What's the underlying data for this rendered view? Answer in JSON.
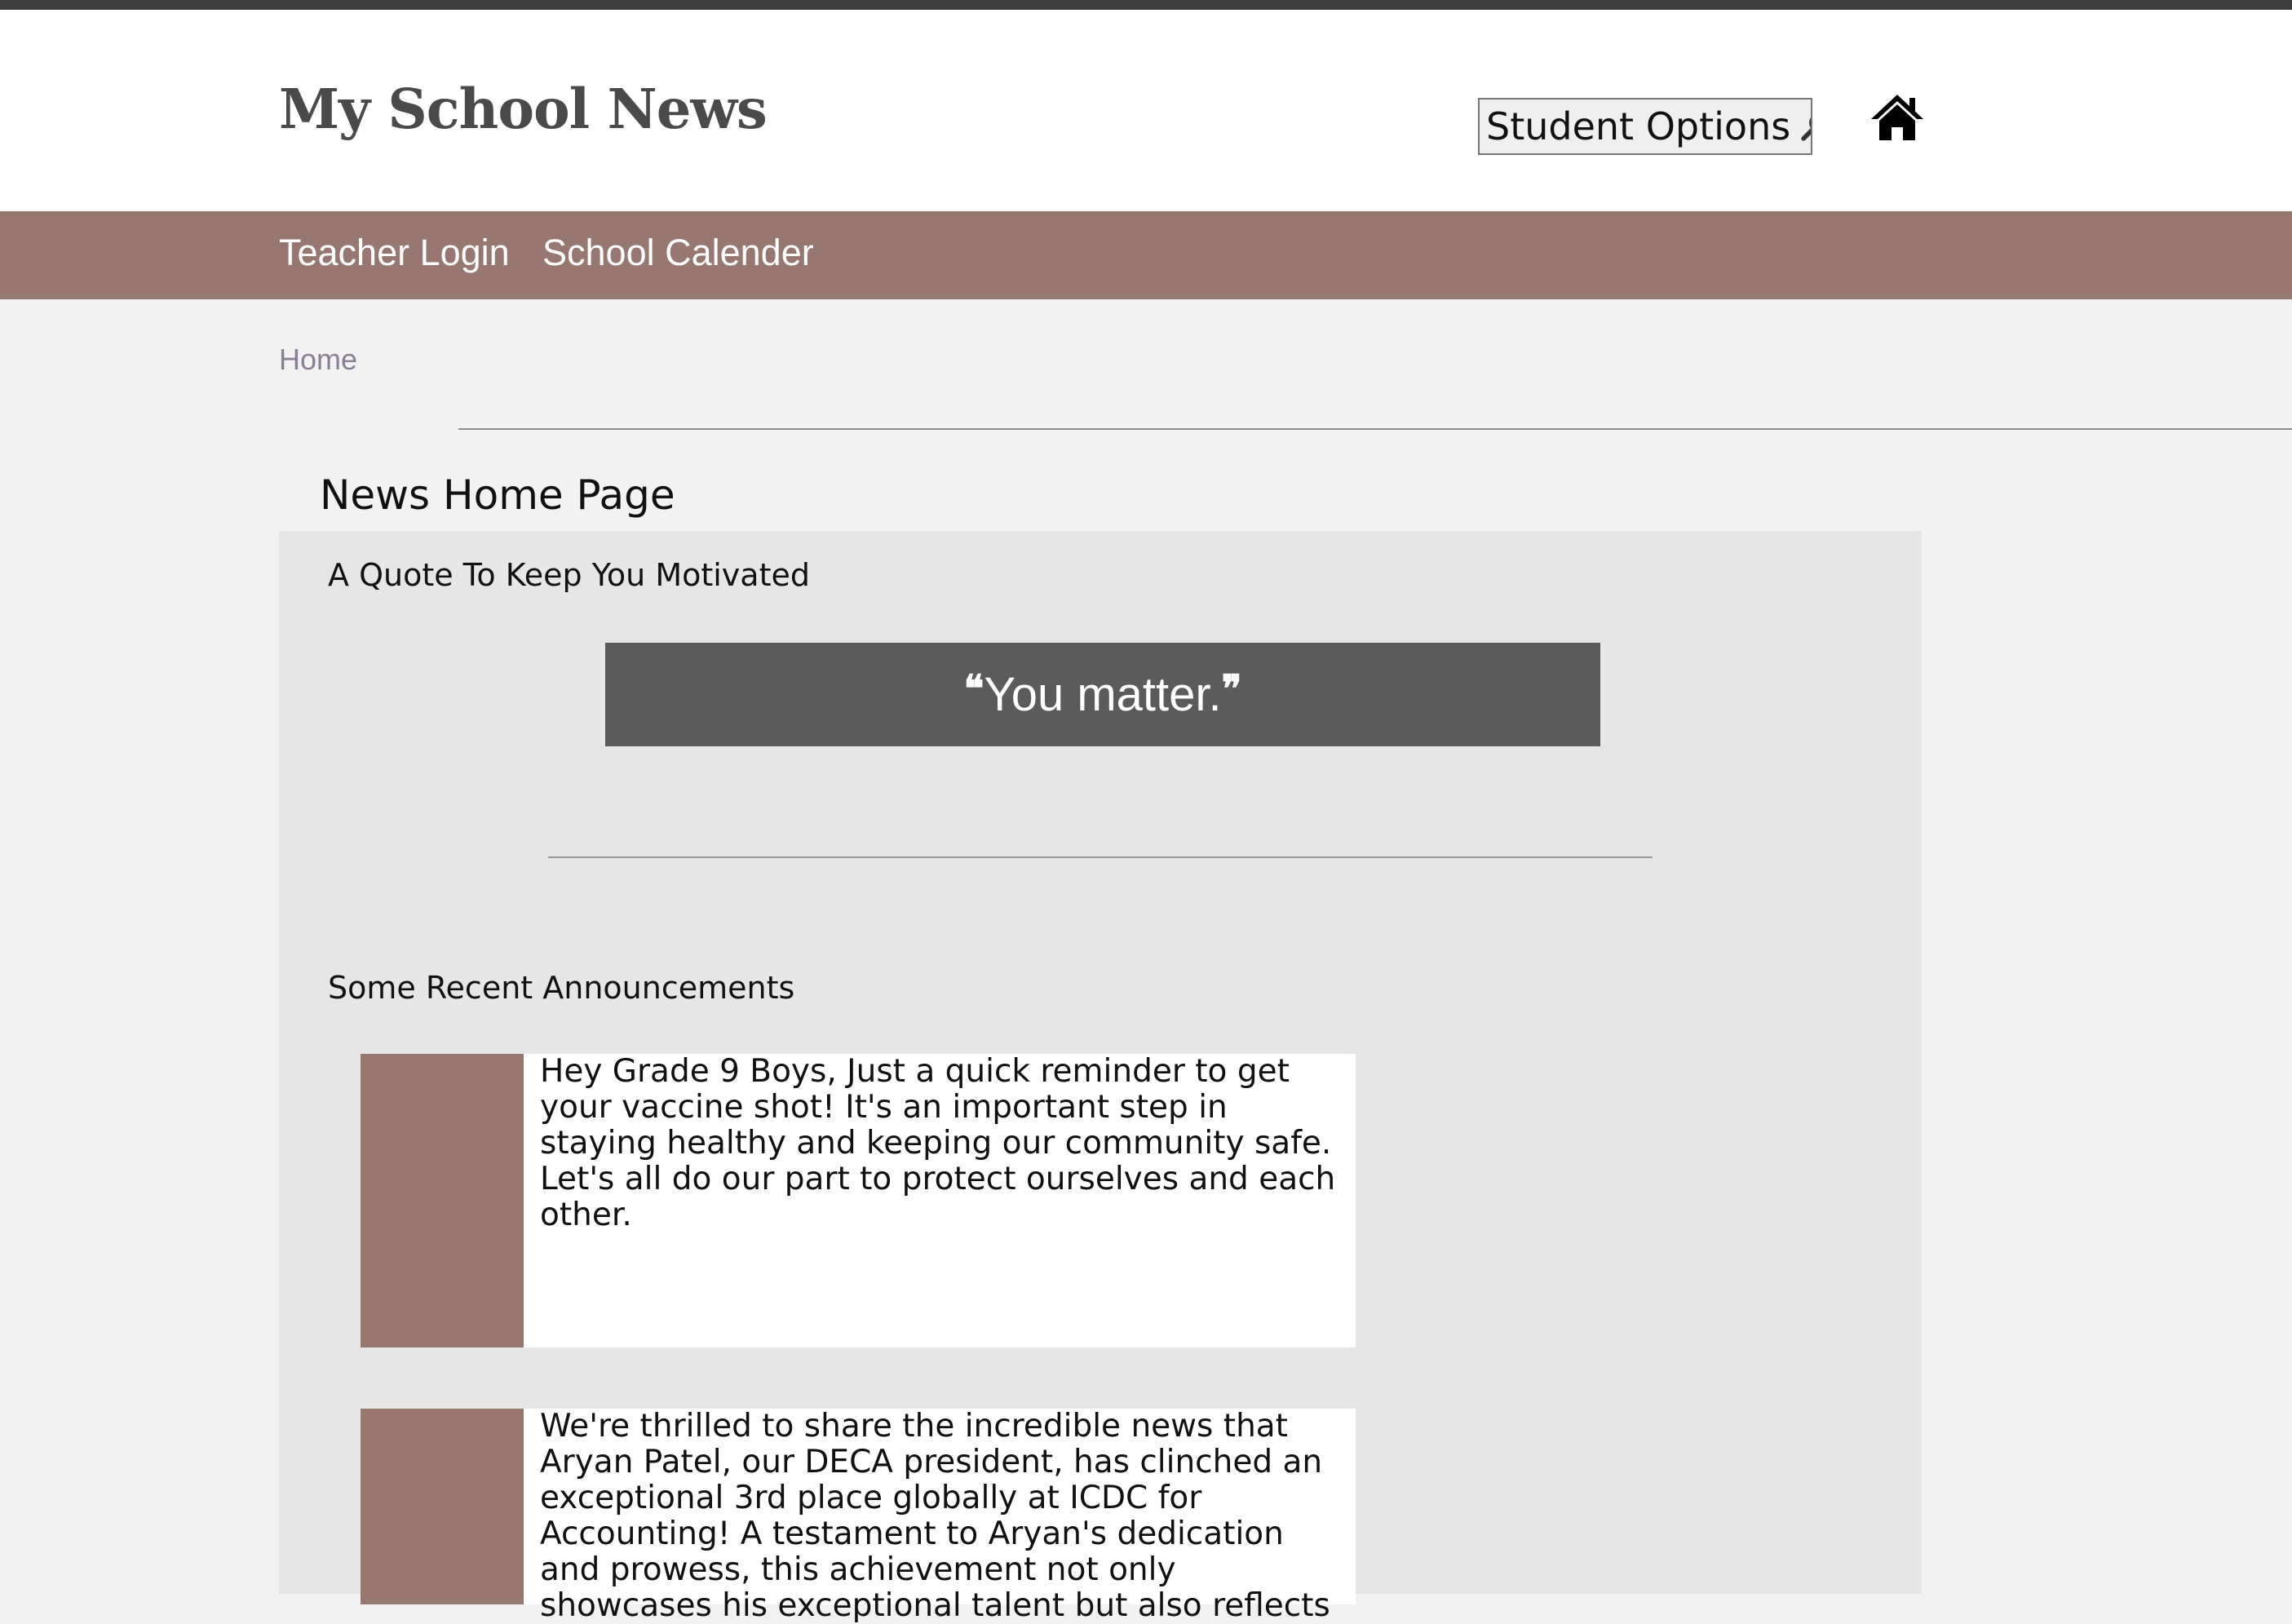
{
  "header": {
    "site_title": "My School News",
    "student_options_label": "Student Options",
    "search_icon": "magnifier-icon",
    "home_icon": "home-icon"
  },
  "nav": {
    "items": [
      {
        "label": "Teacher Login"
      },
      {
        "label": "School Calender"
      }
    ]
  },
  "breadcrumb": {
    "home": "Home"
  },
  "page": {
    "title": "News Home Page"
  },
  "quote_section": {
    "heading": "A Quote To Keep You Motivated",
    "open_mark": "❝",
    "quote": "You matter.",
    "close_mark": "❞"
  },
  "announcements_section": {
    "heading": "Some Recent Announcements",
    "items": [
      {
        "text": "Hey Grade 9 Boys, Just a quick reminder to get your vaccine shot! It's an important step in staying healthy and keeping our community safe. Let's all do our part to protect ourselves and each other."
      },
      {
        "text": "We're thrilled to share the incredible news that Aryan Patel, our DECA president, has clinched an exceptional 3rd place globally at ICDC for Accounting! A testament to Aryan's dedication and prowess, this achievement not only showcases his exceptional talent but also reflects"
      }
    ]
  },
  "colors": {
    "accent": "#97776f",
    "topbar": "#3c3c3c",
    "quote_bg": "#5b5b5b",
    "page_bg": "#f2f2f2",
    "panel_bg": "#e6e6e6"
  }
}
